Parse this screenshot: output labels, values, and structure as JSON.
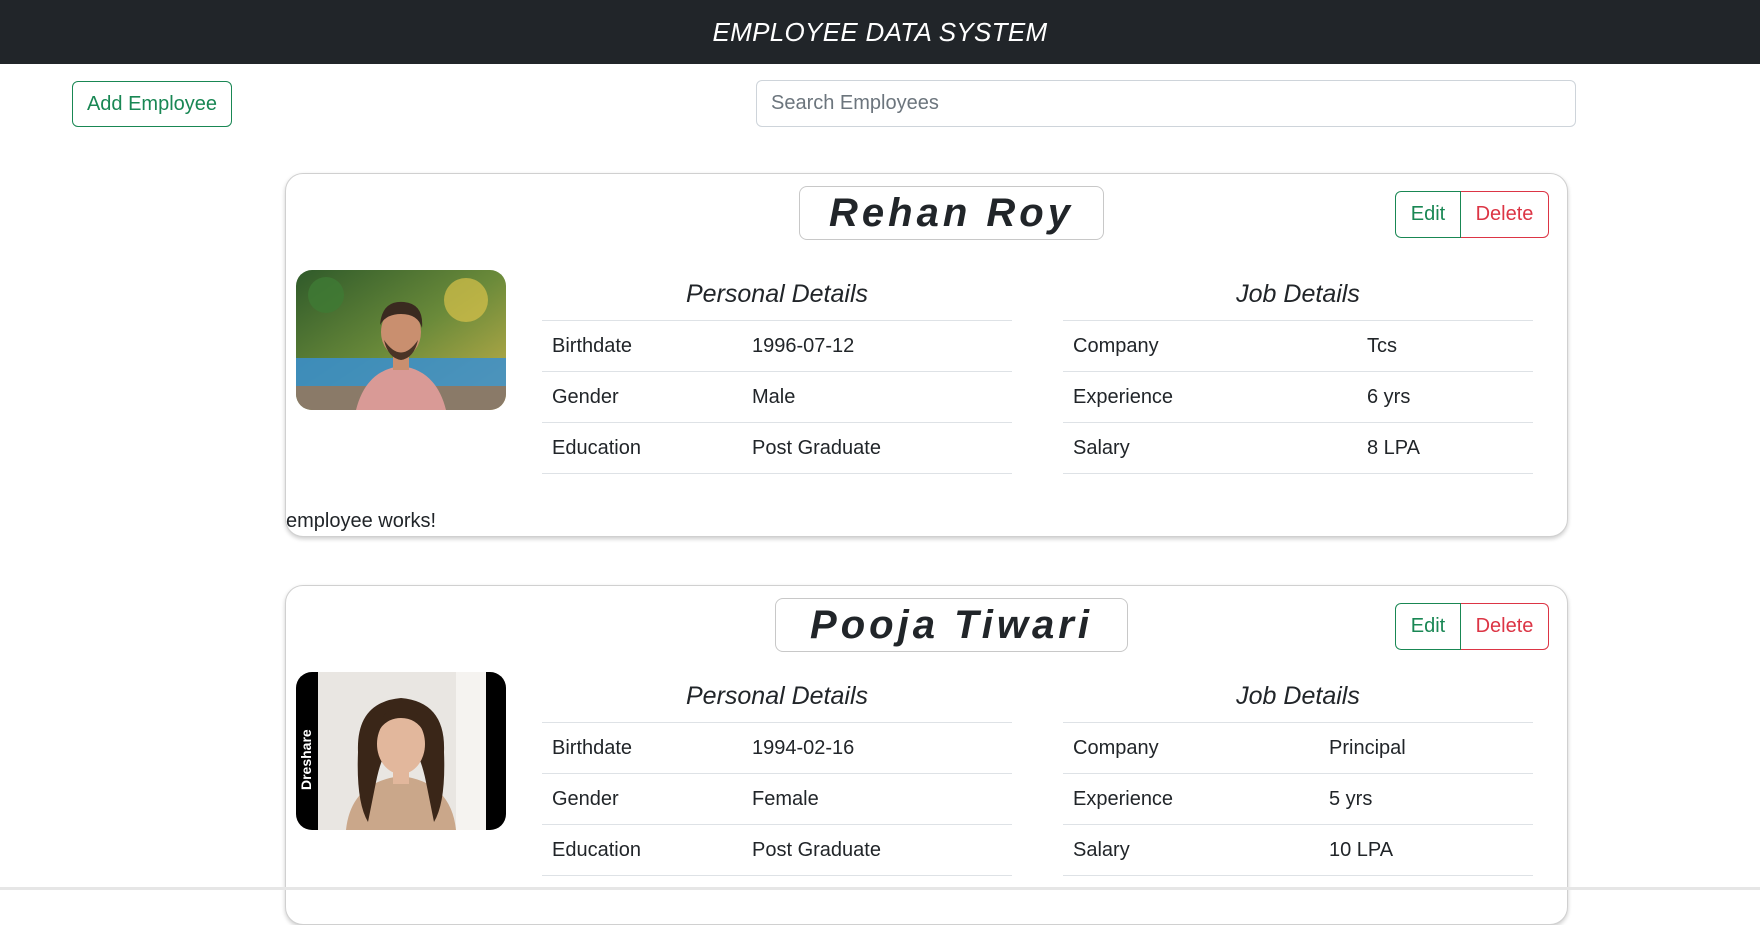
{
  "navbar": {
    "title": "EMPLOYEE DATA SYSTEM"
  },
  "toolbar": {
    "add_label": "Add Employee",
    "search_placeholder": "Search Employees"
  },
  "employees": [
    {
      "name": "Rehan Roy",
      "edit_label": "Edit",
      "delete_label": "Delete",
      "personal_title": "Personal Details",
      "job_title": "Job Details",
      "personal": [
        {
          "label": "Birthdate",
          "value": "1996-07-12"
        },
        {
          "label": "Gender",
          "value": "Male"
        },
        {
          "label": "Education",
          "value": "Post Graduate"
        }
      ],
      "job": [
        {
          "label": "Company",
          "value": "Tcs"
        },
        {
          "label": "Experience",
          "value": "6 yrs"
        },
        {
          "label": "Salary",
          "value": "8 LPA"
        }
      ],
      "footer": "employee works!"
    },
    {
      "name": "Pooja Tiwari",
      "edit_label": "Edit",
      "delete_label": "Delete",
      "personal_title": "Personal Details",
      "job_title": "Job Details",
      "personal": [
        {
          "label": "Birthdate",
          "value": "1994-02-16"
        },
        {
          "label": "Gender",
          "value": "Female"
        },
        {
          "label": "Education",
          "value": "Post Graduate"
        }
      ],
      "job": [
        {
          "label": "Company",
          "value": "Principal"
        },
        {
          "label": "Experience",
          "value": "5 yrs"
        },
        {
          "label": "Salary",
          "value": "10 LPA"
        }
      ],
      "photo_watermark": "Dreshare"
    }
  ],
  "colors": {
    "navbar": "#212529",
    "success": "#198754",
    "danger": "#dc3545"
  }
}
